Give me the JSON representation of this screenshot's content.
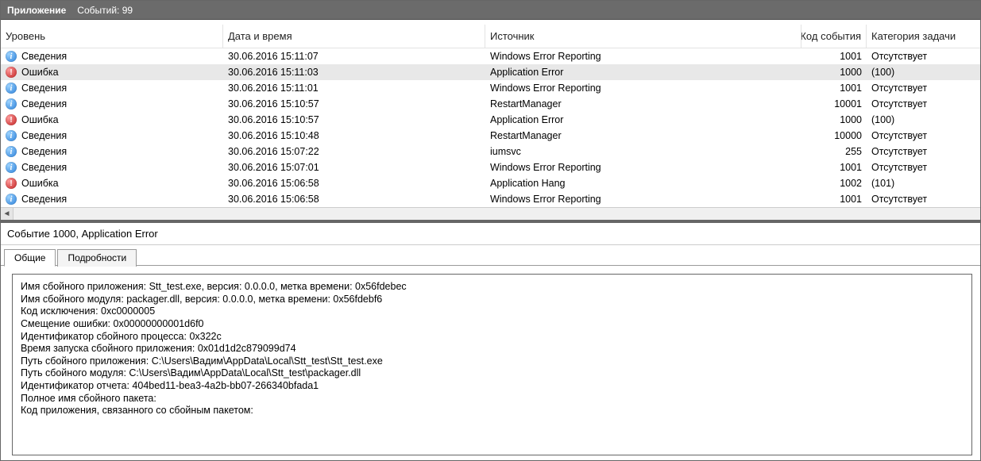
{
  "titlebar": {
    "app_label": "Приложение",
    "count_label": "Событий: 99"
  },
  "columns": {
    "level": "Уровень",
    "date": "Дата и время",
    "source": "Источник",
    "eventid": "Код события",
    "taskcat": "Категория задачи"
  },
  "levels": {
    "info": "Сведения",
    "error": "Ошибка"
  },
  "events": [
    {
      "level": "info",
      "date": "30.06.2016 15:11:07",
      "source": "Windows Error Reporting",
      "eventid": "1001",
      "taskcat": "Отсутствует",
      "selected": false
    },
    {
      "level": "error",
      "date": "30.06.2016 15:11:03",
      "source": "Application Error",
      "eventid": "1000",
      "taskcat": "(100)",
      "selected": true
    },
    {
      "level": "info",
      "date": "30.06.2016 15:11:01",
      "source": "Windows Error Reporting",
      "eventid": "1001",
      "taskcat": "Отсутствует",
      "selected": false
    },
    {
      "level": "info",
      "date": "30.06.2016 15:10:57",
      "source": "RestartManager",
      "eventid": "10001",
      "taskcat": "Отсутствует",
      "selected": false
    },
    {
      "level": "error",
      "date": "30.06.2016 15:10:57",
      "source": "Application Error",
      "eventid": "1000",
      "taskcat": "(100)",
      "selected": false
    },
    {
      "level": "info",
      "date": "30.06.2016 15:10:48",
      "source": "RestartManager",
      "eventid": "10000",
      "taskcat": "Отсутствует",
      "selected": false
    },
    {
      "level": "info",
      "date": "30.06.2016 15:07:22",
      "source": "iumsvc",
      "eventid": "255",
      "taskcat": "Отсутствует",
      "selected": false
    },
    {
      "level": "info",
      "date": "30.06.2016 15:07:01",
      "source": "Windows Error Reporting",
      "eventid": "1001",
      "taskcat": "Отсутствует",
      "selected": false
    },
    {
      "level": "error",
      "date": "30.06.2016 15:06:58",
      "source": "Application Hang",
      "eventid": "1002",
      "taskcat": "(101)",
      "selected": false
    },
    {
      "level": "info",
      "date": "30.06.2016 15:06:58",
      "source": "Windows Error Reporting",
      "eventid": "1001",
      "taskcat": "Отсутствует",
      "selected": false
    }
  ],
  "details": {
    "title": "Событие 1000, Application Error",
    "tabs": {
      "general": "Общие",
      "details": "Подробности"
    },
    "lines": [
      "Имя сбойного приложения: Stt_test.exe, версия: 0.0.0.0, метка времени: 0x56fdebec",
      "Имя сбойного модуля: packager.dll, версия: 0.0.0.0, метка времени: 0x56fdebf6",
      "Код исключения: 0xc0000005",
      "Смещение ошибки: 0x00000000001d6f0",
      "Идентификатор сбойного процесса: 0x322c",
      "Время запуска сбойного приложения: 0x01d1d2c879099d74",
      "Путь сбойного приложения: C:\\Users\\Вадим\\AppData\\Local\\Stt_test\\Stt_test.exe",
      "Путь сбойного модуля: C:\\Users\\Вадим\\AppData\\Local\\Stt_test\\packager.dll",
      "Идентификатор отчета: 404bed11-bea3-4a2b-bb07-266340bfada1",
      "Полное имя сбойного пакета:",
      "Код приложения, связанного со сбойным пакетом:"
    ]
  }
}
